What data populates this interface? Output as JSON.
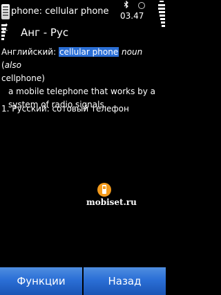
{
  "status": {
    "title": "phone: cellular phone",
    "clock": "03.47"
  },
  "header": {
    "lang_pair": "Анг - Рус"
  },
  "entry": {
    "source_lang": "Английский:",
    "headword": "cellular phone",
    "pos": "noun",
    "paren_open": " (",
    "also": "also",
    "alt_form": "cellphone)",
    "definition_line1": "a mobile telephone that works by a",
    "definition_line2": "system of radio signals."
  },
  "translation": {
    "number": "1.",
    "target_lang": "Русский:",
    "text": "сотовый телефон"
  },
  "watermark": {
    "text": "mobiset.ru"
  },
  "softkeys": {
    "left": "Функции",
    "right": "Назад"
  },
  "colors": {
    "highlight": "#2b6fd6",
    "softkey": "#2b6fd6",
    "logo": "#f39a1b"
  }
}
